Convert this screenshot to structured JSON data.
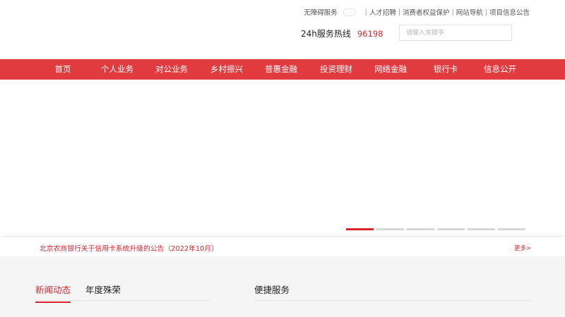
{
  "utility": {
    "accessibility_label": "无障碍服务",
    "links": [
      "人才招聘",
      "消费者权益保护",
      "网站导航",
      "项目信息公告"
    ]
  },
  "hotline": {
    "label": "24h服务热线",
    "number": "96198"
  },
  "search": {
    "placeholder": "请输入关键字"
  },
  "nav": {
    "items": [
      "首页",
      "个人业务",
      "对公业务",
      "乡村振兴",
      "普惠金融",
      "投资理财",
      "网络金融",
      "银行卡",
      "信息公开"
    ]
  },
  "banner": {
    "slide_count": 6,
    "active_slide": 1
  },
  "notice": {
    "text": "北京农商银行关于信用卡系统升级的公告（2022年10月）",
    "more": "更多>"
  },
  "news": {
    "tabs": [
      "新闻动态",
      "年度殊荣"
    ],
    "active_tab": 0
  },
  "services": {
    "title": "便捷服务"
  },
  "colors": {
    "brand_red": "#e13a3f",
    "accent_red": "#d9262c"
  }
}
